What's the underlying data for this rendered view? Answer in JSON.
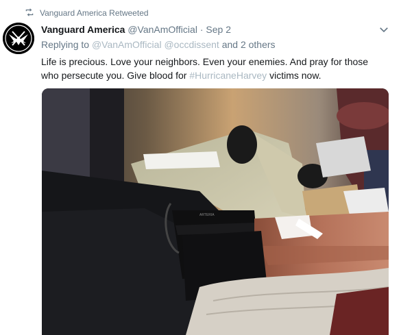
{
  "retweet": {
    "icon": "retweet-icon",
    "text": "Vanguard America Retweeted"
  },
  "tweet": {
    "avatar_icon": "eagle-logo-icon",
    "display_name": "Vanguard America",
    "handle": "@VanAmOfficial",
    "separator": "·",
    "date": "Sep 2",
    "menu_icon": "chevron-down-icon",
    "reply": {
      "prefix": "Replying to",
      "mention1": "@VanAmOfficial",
      "mention2": "@occdissent",
      "suffix": "and 2 others"
    },
    "text": {
      "part1": "Life is precious. Love your neighbors. Even your enemies. And pray for those who persecute you. Give blood for",
      "hashtag": "#HurricaneHarvey",
      "part2": "victims now."
    },
    "media": {
      "description_icon": "photo-blood-donation",
      "cuff_text": "ARTERIA"
    }
  },
  "colors": {
    "link": "#aab8c2",
    "secondary": "#657786",
    "primary_text": "#14171a"
  }
}
